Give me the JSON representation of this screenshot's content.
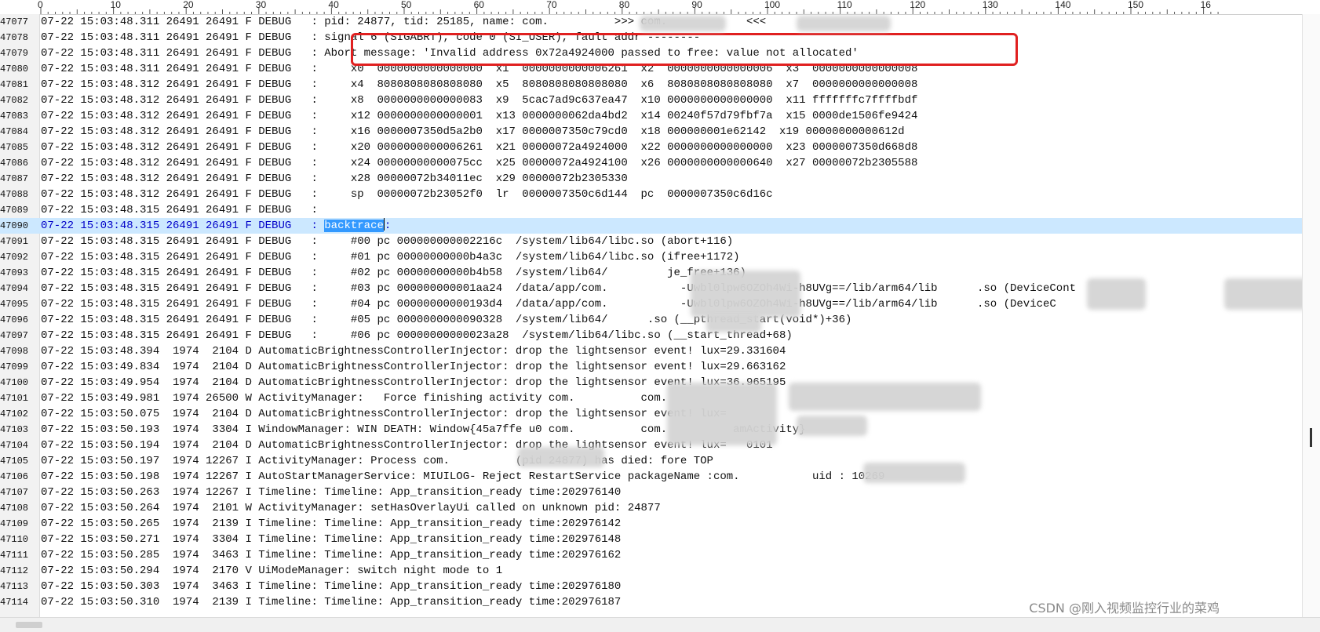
{
  "ruler": {
    "labels": [
      "0",
      "10",
      "20",
      "30",
      "40",
      "50",
      "60",
      "70",
      "80",
      "90",
      "100",
      "110",
      "120",
      "130",
      "140",
      "150",
      "16"
    ]
  },
  "lines": [
    {
      "n": "47077",
      "text": "07-22 15:03:48.311 26491 26491 F DEBUG   : pid: 24877, tid: 25185, name: com.          >>> com.            <<<"
    },
    {
      "n": "47078",
      "text": "07-22 15:03:48.311 26491 26491 F DEBUG   : signal 6 (SIGABRT), code 0 (SI_USER), fault addr --------"
    },
    {
      "n": "47079",
      "text": "07-22 15:03:48.311 26491 26491 F DEBUG   : Abort message: 'Invalid address 0x72a4924000 passed to free: value not allocated'"
    },
    {
      "n": "47080",
      "text": "07-22 15:03:48.311 26491 26491 F DEBUG   :     x0  0000000000000000  x1  0000000000006261  x2  0000000000000006  x3  0000000000000008"
    },
    {
      "n": "47081",
      "text": "07-22 15:03:48.312 26491 26491 F DEBUG   :     x4  8080808080808080  x5  8080808080808080  x6  8080808080808080  x7  0000000000000008"
    },
    {
      "n": "47082",
      "text": "07-22 15:03:48.312 26491 26491 F DEBUG   :     x8  0000000000000083  x9  5cac7ad9c637ea47  x10 0000000000000000  x11 fffffffc7ffffbdf"
    },
    {
      "n": "47083",
      "text": "07-22 15:03:48.312 26491 26491 F DEBUG   :     x12 0000000000000001  x13 0000000062da4bd2  x14 00240f57d79fbf7a  x15 0000de1506fe9424"
    },
    {
      "n": "47084",
      "text": "07-22 15:03:48.312 26491 26491 F DEBUG   :     x16 0000007350d5a2b0  x17 0000007350c79cd0  x18 000000001e62142  x19 00000000000612d"
    },
    {
      "n": "47085",
      "text": "07-22 15:03:48.312 26491 26491 F DEBUG   :     x20 0000000000006261  x21 00000072a4924000  x22 0000000000000000  x23 0000007350d668d8"
    },
    {
      "n": "47086",
      "text": "07-22 15:03:48.312 26491 26491 F DEBUG   :     x24 00000000000075cc  x25 00000072a4924100  x26 0000000000000640  x27 00000072b2305588"
    },
    {
      "n": "47087",
      "text": "07-22 15:03:48.312 26491 26491 F DEBUG   :     x28 00000072b34011ec  x29 00000072b2305330"
    },
    {
      "n": "47088",
      "text": "07-22 15:03:48.312 26491 26491 F DEBUG   :     sp  00000072b23052f0  lr  0000007350c6d144  pc  0000007350c6d16c"
    },
    {
      "n": "47089",
      "text": "07-22 15:03:48.315 26491 26491 F DEBUG   :"
    },
    {
      "n": "47090",
      "prefix": "07-22 15:03:48.315 26491 26491 F DEBUG   : ",
      "selected": "backtrace",
      "suffix": ":"
    },
    {
      "n": "47091",
      "text": "07-22 15:03:48.315 26491 26491 F DEBUG   :     #00 pc 000000000002216c  /system/lib64/libc.so (abort+116)"
    },
    {
      "n": "47092",
      "text": "07-22 15:03:48.315 26491 26491 F DEBUG   :     #01 pc 00000000000b4a3c  /system/lib64/libc.so (ifree+1172)"
    },
    {
      "n": "47093",
      "text": "07-22 15:03:48.315 26491 26491 F DEBUG   :     #02 pc 00000000000b4b58  /system/lib64/         je_free+136)"
    },
    {
      "n": "47094",
      "text": "07-22 15:03:48.315 26491 26491 F DEBUG   :     #03 pc 000000000001aa24  /data/app/com.           -Uwbl0lpw6OZOh4Wi-h8UVg==/lib/arm64/lib      .so (DeviceCont"
    },
    {
      "n": "47095",
      "text": "07-22 15:03:48.315 26491 26491 F DEBUG   :     #04 pc 00000000000193d4  /data/app/com.           -Uwbl0lpw6OZOh4Wi-h8UVg==/lib/arm64/lib      .so (DeviceC"
    },
    {
      "n": "47096",
      "text": "07-22 15:03:48.315 26491 26491 F DEBUG   :     #05 pc 0000000000090328  /system/lib64/      .so (__pthread_start(void*)+36)"
    },
    {
      "n": "47097",
      "text": "07-22 15:03:48.315 26491 26491 F DEBUG   :     #06 pc 00000000000023a28  /system/lib64/libc.so (__start_thread+68)"
    },
    {
      "n": "47098",
      "text": "07-22 15:03:48.394  1974  2104 D AutomaticBrightnessControllerInjector: drop the lightsensor event! lux=29.331604"
    },
    {
      "n": "47099",
      "text": "07-22 15:03:49.834  1974  2104 D AutomaticBrightnessControllerInjector: drop the lightsensor event! lux=29.663162"
    },
    {
      "n": "47100",
      "text": "07-22 15:03:49.954  1974  2104 D AutomaticBrightnessControllerInjector: drop the lightsensor event! lux=36.965195"
    },
    {
      "n": "47101",
      "text": "07-22 15:03:49.981  1974 26500 W ActivityManager:   Force finishing activity com.          com."
    },
    {
      "n": "47102",
      "text": "07-22 15:03:50.075  1974  2104 D AutomaticBrightnessControllerInjector: drop the lightsensor event! lux=    "
    },
    {
      "n": "47103",
      "text": "07-22 15:03:50.193  1974  3304 I WindowManager: WIN DEATH: Window{45a7ffe u0 com.          com.          amActivity}"
    },
    {
      "n": "47104",
      "text": "07-22 15:03:50.194  1974  2104 D AutomaticBrightnessControllerInjector: drop the lightsensor event! lux=   0101"
    },
    {
      "n": "47105",
      "text": "07-22 15:03:50.197  1974 12267 I ActivityManager: Process com.          (pid 24877) has died: fore TOP"
    },
    {
      "n": "47106",
      "text": "07-22 15:03:50.198  1974 12267 I AutoStartManagerService: MIUILOG- Reject RestartService packageName :com.           uid : 10269"
    },
    {
      "n": "47107",
      "text": "07-22 15:03:50.263  1974 12267 I Timeline: Timeline: App_transition_ready time:202976140"
    },
    {
      "n": "47108",
      "text": "07-22 15:03:50.264  1974  2101 W ActivityManager: setHasOverlayUi called on unknown pid: 24877"
    },
    {
      "n": "47109",
      "text": "07-22 15:03:50.265  1974  2139 I Timeline: Timeline: App_transition_ready time:202976142"
    },
    {
      "n": "47110",
      "text": "07-22 15:03:50.271  1974  3304 I Timeline: Timeline: App_transition_ready time:202976148"
    },
    {
      "n": "47111",
      "text": "07-22 15:03:50.285  1974  3463 I Timeline: Timeline: App_transition_ready time:202976162"
    },
    {
      "n": "47112",
      "text": "07-22 15:03:50.294  1974  2170 V UiModeManager: switch night mode to 1"
    },
    {
      "n": "47113",
      "text": "07-22 15:03:50.303  1974  3463 I Timeline: Timeline: App_transition_ready time:202976180"
    },
    {
      "n": "47114",
      "text": "07-22 15:03:50.310  1974  2139 I Timeline: Timeline: App_transition_ready time:202976187"
    }
  ],
  "current_line_index": 13,
  "watermark": "CSDN @刚入视频监控行业的菜鸡"
}
